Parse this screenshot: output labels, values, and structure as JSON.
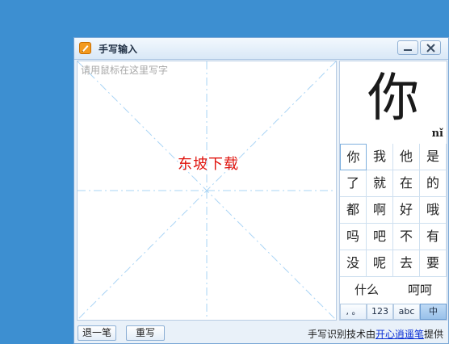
{
  "window": {
    "title": "手写输入",
    "icons": {
      "app": "pen-icon",
      "minimize": "minimize-icon",
      "close": "close-icon"
    }
  },
  "canvas": {
    "hint": "请用鼠标在这里写字",
    "watermark": "东坡下载",
    "colors": {
      "guides": "#a9d4f5",
      "watermark": "#e0140e"
    }
  },
  "preview": {
    "char": "你",
    "pinyin": "nǐ"
  },
  "candidates": [
    [
      "你",
      "我",
      "他",
      "是"
    ],
    [
      "了",
      "就",
      "在",
      "的"
    ],
    [
      "都",
      "啊",
      "好",
      "哦"
    ],
    [
      "吗",
      "吧",
      "不",
      "有"
    ],
    [
      "没",
      "呢",
      "去",
      "要"
    ]
  ],
  "phrases": [
    "什么",
    "呵呵"
  ],
  "modes": [
    {
      "label": ", 。",
      "name": "punctuation"
    },
    {
      "label": "123",
      "name": "numbers"
    },
    {
      "label": "abc",
      "name": "letters"
    },
    {
      "label": "中",
      "name": "chinese",
      "active": true
    }
  ],
  "buttons": {
    "undo": "退一笔",
    "rewrite": "重写"
  },
  "credit": {
    "prefix": "手写识别技术由",
    "link": "开心逍遥笔",
    "suffix": "提供"
  },
  "colors": {
    "desktop": "#3d8fd1",
    "window": "#e9f1f9",
    "link": "#0a2fd4"
  }
}
